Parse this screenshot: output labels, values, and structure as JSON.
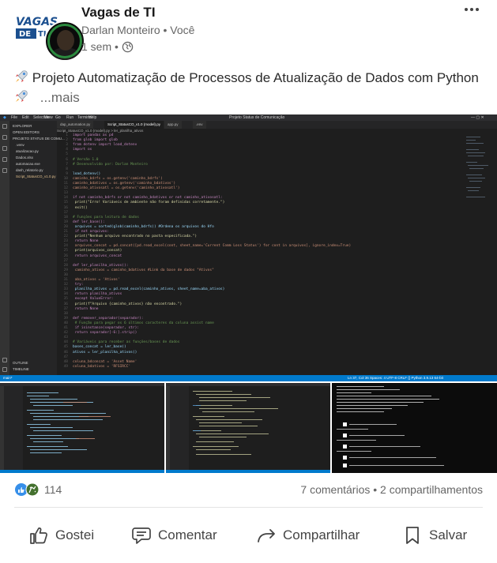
{
  "post": {
    "poster_name": "Vagas de TI",
    "author": "Darlan Monteiro • Você",
    "time": "1 sem •",
    "text": "Projeto Automatização de Processos de Atualização de Dados com Python",
    "see_more": "...mais",
    "logo_text": "VAGAS DE TI",
    "more_icon": "more-icon"
  },
  "screenshot": {
    "window_title": "Projeto Status de Comunicação",
    "menu": [
      "File",
      "Edit",
      "Selection",
      "View",
      "Go",
      "Run",
      "Terminal",
      "Help"
    ],
    "sidebar_header": "EXPLORER",
    "sidebar_section": "OPEN EDITORS",
    "sidebar_project": "PROJETO STATUS DE COMU...",
    "files": [
      ".venv",
      "atualizacao.py",
      "Dados.xlsx",
      "automacao.exe",
      "dash_relatorio.py",
      "Script_StatusCO_v1.0.py"
    ],
    "sidebar_outline": "OUTLINE",
    "sidebar_timeline": "TIMELINE",
    "tabs": [
      "dap_automation.py",
      "Script_StatusCO_v1.0 (model).py",
      "app.py",
      ".env"
    ],
    "breadcrumb": "Script_StatusCO_v1.0 (model).py > ler_planilha_ativos",
    "code": [
      "import pandas as pd",
      "from glob import glob",
      "from dotenv import load_dotenv",
      "import os",
      "",
      "# Versão 1.0",
      "# Desenvolvido por: Darlan Monteiro",
      "",
      "load_dotenv()",
      "caminho_bdrfs = os.getenv('caminho_bdrfs')",
      "caminho_bdativos = os.getenv('caminho_bdativos')",
      "caminho_ativosatl = os.getenv('caminho_ativosatl')",
      "",
      "if not caminho_bdrfs or not caminho_bdativos or not caminho_ativosatl:",
      "    print(\"Erro! Variáveis de ambiente não foram definidas corretamente.\")",
      "    exit()",
      "",
      "# Funções para leitura de dados",
      "def ler_base():",
      "    arquivos = sorted(glob(caminho_bdrfs)) #Ordena os arquivos do Hfo",
      "    if not arquivos:",
      "        print(\"Nenhum arquivo encontrado no pasta especificada.\")",
      "        return None",
      "    arquivos_concat = pd.concat([pd.read_excel(cont, sheet_name='Current Comm Loss Status') for cont in arquivos], ignore_index=True)",
      "    print(arquivos_concat)",
      "    return arquivos_concat",
      "",
      "def ler_planilha_ativos():",
      "    caminho_ativos = caminho_bdativos #Link da base de dados \"Ativos\"",
      "",
      "    aba_ativos = 'Ativos'",
      "    try:",
      "        planilha_ativos = pd.read_excel(caminho_ativos, sheet_name=aba_ativos)",
      "        return planilha_ativos",
      "    except ValueError:",
      "        print(f\"Arquivo {caminho_ativos} não encontrado.\")",
      "        return None",
      "",
      "def remover_separador(separador):",
      "    # Função para pegar os 6 últimos caracteres da coluna assist name",
      "    if isinstance(separador, str):",
      "        return separador[-6:].strip()",
      "",
      "# Variáveis para receber as funções/bases de dados",
      "bases_concat = ler_base()",
      "ativos = ler_planilha_ativos()",
      "",
      "coluna_bdconcat = 'Asset Name'",
      "coluna_bdativos = 'RFSIRCC'"
    ],
    "status_left": "main*",
    "status_right": "Ln 37, Col 36   Spaces: 4   UTF-8   CRLF   {} Python   3.9.13 64-bit"
  },
  "thumbnails": [
    {
      "label": "code-screenshot-2"
    },
    {
      "label": "code-screenshot-3"
    },
    {
      "label": "terminal-screenshot"
    }
  ],
  "terminal_lines": [
    "Arquivo RFSIRCC lido e atualizado",
    "RFSIRCC atualizado 2024-01-09 14:21:56",
    "RFSIRCC atualizado 2024-01-09 14:20:24",
    "RFSIRCC atualizado 2024-01-09 15:10:33",
    "RFSIRCC atualizado 2024-01-09 14:29:50",
    "RFSIRCC atualizado 2024-01-09 14:59:13",
    "RFSIRCC atualizado 2024-01-09 14:53:13",
    "RFSIRCC atualizado 2024-01-09 14:51:21"
  ],
  "social": {
    "reaction_count": "114",
    "comments": "7 comentários",
    "separator": " • ",
    "shares": "2 compartilhamentos"
  },
  "actions": {
    "like": "Gostei",
    "comment": "Comentar",
    "share": "Compartilhar",
    "save": "Salvar"
  },
  "colors": {
    "vscode_bg": "#1e1e1e",
    "status_bar": "#007acc",
    "like_blue": "#378fe9",
    "celebrate_green": "#44712e"
  }
}
